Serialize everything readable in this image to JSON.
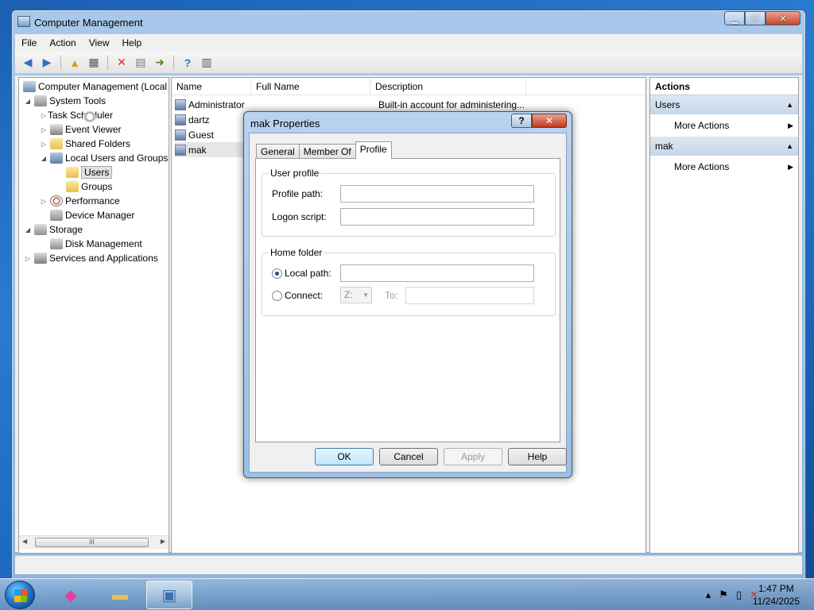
{
  "window": {
    "title": "Computer Management",
    "caption": {
      "minimize": "▁",
      "maximize": "□",
      "close": "✕"
    }
  },
  "menu": [
    "File",
    "Action",
    "View",
    "Help"
  ],
  "toolbar_icons": [
    "back-icon",
    "forward-icon",
    "up-folder-icon",
    "show-hide-tree-icon",
    "delete-icon",
    "properties-icon",
    "export-list-icon",
    "help-icon",
    "show-hide-action-pane-icon"
  ],
  "tree": {
    "root": "Computer Management (Local",
    "system_tools": "System Tools",
    "task_scheduler": "Task Scheduler",
    "event_viewer": "Event Viewer",
    "shared_folders": "Shared Folders",
    "local_users_groups": "Local Users and Groups",
    "users": "Users",
    "groups": "Groups",
    "performance": "Performance",
    "device_manager": "Device Manager",
    "storage": "Storage",
    "disk_management": "Disk Management",
    "services_apps": "Services and Applications",
    "scroll_grip": "III"
  },
  "list": {
    "columns": [
      "Name",
      "Full Name",
      "Description"
    ],
    "rows": [
      {
        "name": "Administrator",
        "full_name": "",
        "description": "Built-in account for administering..."
      },
      {
        "name": "dartz",
        "full_name": "",
        "description": ""
      },
      {
        "name": "Guest",
        "full_name": "",
        "description": ""
      },
      {
        "name": "mak",
        "full_name": "",
        "description": ""
      }
    ]
  },
  "actions": {
    "title": "Actions",
    "groups": [
      {
        "label": "Users",
        "item": "More Actions"
      },
      {
        "label": "mak",
        "item": "More Actions"
      }
    ]
  },
  "dialog": {
    "title": "mak Properties",
    "help": "?",
    "close": "✕",
    "tabs": [
      "General",
      "Member Of",
      "Profile"
    ],
    "active_tab": "Profile",
    "user_profile": {
      "group_label": "User profile",
      "profile_path_label": "Profile path:",
      "profile_path_value": "",
      "logon_script_label": "Logon script:",
      "logon_script_value": ""
    },
    "home_folder": {
      "group_label": "Home folder",
      "local_path_label": "Local path:",
      "local_path_selected": true,
      "local_path_value": "",
      "connect_label": "Connect:",
      "drive": "Z:",
      "to_label": "To:",
      "to_value": ""
    },
    "buttons": {
      "ok": "OK",
      "cancel": "Cancel",
      "apply": "Apply",
      "help": "Help"
    }
  },
  "taskbar": {
    "time": "1:47 PM",
    "date": "11/24/2025",
    "tray_icons": [
      "show-hidden-icons-icon",
      "action-center-flag-icon",
      "network-icon",
      "volume-muted-icon"
    ]
  }
}
